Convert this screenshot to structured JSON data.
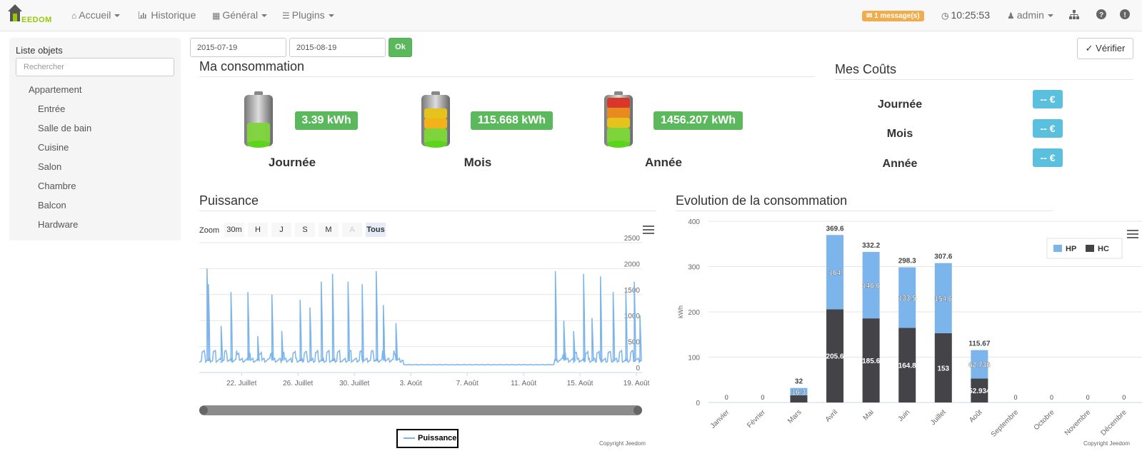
{
  "navbar": {
    "brand": "EEDOM",
    "items": [
      {
        "label": "Accueil",
        "icon": "home-icon"
      },
      {
        "label": "Historique",
        "icon": "bar-chart-icon"
      },
      {
        "label": "Général",
        "icon": "dashboard-icon"
      },
      {
        "label": "Plugins",
        "icon": "tasks-icon"
      }
    ],
    "messages": "1 message(s)",
    "time": "10:25:53",
    "user": "admin"
  },
  "sidebar": {
    "title": "Liste objets",
    "search_placeholder": "Rechercher",
    "items": [
      "Appartement",
      "Entrée",
      "Salle de bain",
      "Cuisine",
      "Salon",
      "Chambre",
      "Balcon",
      "Hardware"
    ]
  },
  "filters": {
    "date_start": "2015-07-19",
    "date_end": "2015-08-19",
    "ok_label": "Ok",
    "verify_label": "Vérifier"
  },
  "consumption": {
    "title": "Ma consommation",
    "items": [
      {
        "period": "Journée",
        "value": "3.39 kWh",
        "level": 0.6
      },
      {
        "period": "Mois",
        "value": "115.668 kWh",
        "level": 0.75
      },
      {
        "period": "Année",
        "value": "1456.207 kWh",
        "level": 1.0
      }
    ]
  },
  "costs": {
    "title": "Mes Coûts",
    "items": [
      {
        "period": "Journée",
        "value": "-- €"
      },
      {
        "period": "Mois",
        "value": "-- €"
      },
      {
        "period": "Année",
        "value": "-- €"
      }
    ]
  },
  "colors": {
    "green": "#5cb85c",
    "info": "#5bc0de",
    "hp": "#7cb5ec",
    "hc": "#434348"
  },
  "puissance": {
    "title": "Puissance",
    "zoom_label": "Zoom",
    "zoom_buttons": [
      "30m",
      "H",
      "J",
      "S",
      "M",
      "A",
      "Tous"
    ],
    "legend": "Puissance",
    "copyright": "Copyright Jeedom"
  },
  "evolution": {
    "title": "Evolution de la consommation",
    "copyright": "Copyright Jeedom"
  },
  "chart_data": [
    {
      "type": "line",
      "title": "Puissance",
      "series": [
        {
          "name": "Puissance"
        }
      ],
      "yticks": [
        0,
        500,
        1000,
        1500,
        2000,
        2500
      ],
      "ylim": [
        0,
        2500
      ],
      "xtick_labels": [
        "22. Juillet",
        "26. Juillet",
        "30. Juillet",
        "3. Août",
        "7. Août",
        "11. Août",
        "15. Août",
        "19. Août"
      ],
      "x_day_offsets": [
        3,
        7,
        11,
        15,
        19,
        23,
        27,
        31
      ],
      "x_range_days": [
        0,
        31.4
      ],
      "baseline": 230,
      "spikes": [
        [
          0.6,
          2000
        ],
        [
          0.7,
          1700
        ],
        [
          1.6,
          900
        ],
        [
          2.3,
          1550
        ],
        [
          3.5,
          1550
        ],
        [
          4.2,
          700
        ],
        [
          5.2,
          1500
        ],
        [
          5.9,
          800
        ],
        [
          7.2,
          1400
        ],
        [
          7.9,
          1250
        ],
        [
          8.7,
          1750
        ],
        [
          9.5,
          1900
        ],
        [
          10.6,
          1750
        ],
        [
          11.6,
          1700
        ],
        [
          12.6,
          1950
        ],
        [
          13.1,
          1300
        ],
        [
          14.0,
          950
        ],
        [
          25.3,
          1950
        ],
        [
          25.9,
          1000
        ],
        [
          26.6,
          800
        ],
        [
          27.3,
          1900
        ],
        [
          27.9,
          1050
        ],
        [
          28.5,
          1850
        ],
        [
          29.4,
          1550
        ],
        [
          30.3,
          1550
        ],
        [
          30.9,
          1750
        ],
        [
          31.3,
          1100
        ]
      ],
      "flat_range": [
        14.5,
        25.2
      ],
      "flat_value": 150
    },
    {
      "type": "bar",
      "stacked": true,
      "ylabel": "kWh",
      "ylim": [
        0,
        400
      ],
      "yticks": [
        0,
        100,
        200,
        300,
        400
      ],
      "categories": [
        "Janvier",
        "Février",
        "Mars",
        "Avril",
        "Mai",
        "Juin",
        "Juillet",
        "Août",
        "Septembre",
        "Octobre",
        "Novembre",
        "Décembre"
      ],
      "series": [
        {
          "name": "HP",
          "values": [
            0,
            0,
            16.3,
            164,
            146.6,
            133.5,
            154.6,
            62.736,
            0,
            0,
            0,
            0
          ]
        },
        {
          "name": "HC",
          "values": [
            0,
            0,
            15.7,
            205.6,
            185.6,
            164.8,
            153,
            52.934,
            0,
            0,
            0,
            0
          ]
        }
      ],
      "labels_hp": [
        "0",
        "0",
        "16.3",
        "164",
        "146.6",
        "133.5",
        "154.6",
        "62.736",
        "0",
        "0",
        "0",
        "0"
      ],
      "labels_hc": [
        "",
        "",
        "",
        "205.6",
        "185.6",
        "164.8",
        "153",
        "52.934",
        "",
        "",
        "",
        ""
      ],
      "totals": [
        "",
        "",
        "32",
        "369.6",
        "332.2",
        "298.3",
        "307.6",
        "115.67",
        "",
        "",
        "",
        ""
      ],
      "legend_position": "top-right"
    }
  ]
}
